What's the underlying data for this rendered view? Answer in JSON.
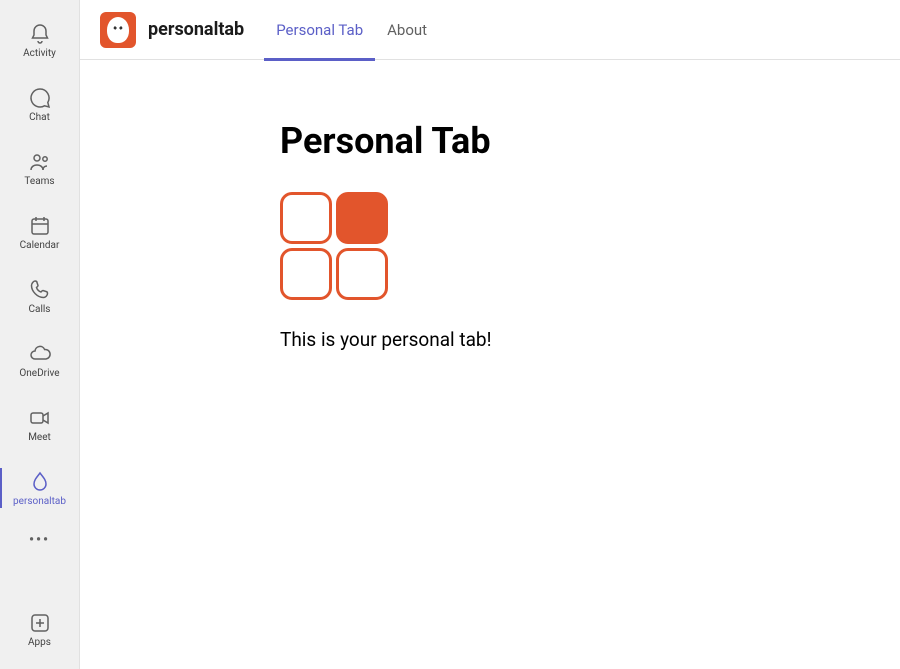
{
  "rail": {
    "items": [
      {
        "label": "Activity"
      },
      {
        "label": "Chat"
      },
      {
        "label": "Teams"
      },
      {
        "label": "Calendar"
      },
      {
        "label": "Calls"
      },
      {
        "label": "OneDrive"
      },
      {
        "label": "Meet"
      },
      {
        "label": "personaltab"
      }
    ],
    "apps_label": "Apps"
  },
  "header": {
    "app_name": "personaltab",
    "tabs": [
      {
        "label": "Personal Tab"
      },
      {
        "label": "About"
      }
    ]
  },
  "content": {
    "heading": "Personal Tab",
    "description": "This is your personal tab!"
  }
}
